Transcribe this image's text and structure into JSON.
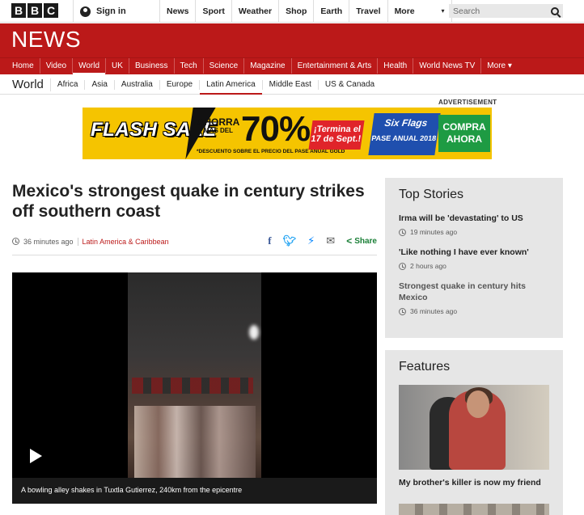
{
  "masthead": {
    "logo_letters": [
      "B",
      "B",
      "C"
    ],
    "signin_label": "Sign in",
    "nav": [
      "News",
      "Sport",
      "Weather",
      "Shop",
      "Earth",
      "Travel"
    ],
    "more_label": "More",
    "search_placeholder": "Search"
  },
  "banner": {
    "title": "NEWS"
  },
  "sections": [
    "Home",
    "Video",
    "World",
    "UK",
    "Business",
    "Tech",
    "Science",
    "Magazine",
    "Entertainment & Arts",
    "Health",
    "World News TV",
    "More"
  ],
  "active_section": "World",
  "subnav": {
    "title": "World",
    "items": [
      "Africa",
      "Asia",
      "Australia",
      "Europe",
      "Latin America",
      "Middle East",
      "US & Canada"
    ],
    "active": "Latin America"
  },
  "advertisement": {
    "label": "ADVERTISEMENT",
    "flash_sale": "FLASH SALE",
    "ahorra": "AHORRA",
    "mas_del": "MAS DEL",
    "percent": "70%",
    "disclaimer": "*DESCUENTO SOBRE EL PRECIO DEL PASE ANUAL GOLD",
    "termina": "¡Termina el 17 de Sept.!",
    "six_flags": "Six Flags",
    "pase_anual": "PASE ANUAL 2018",
    "compra": "COMPRA AHORA"
  },
  "article": {
    "headline": "Mexico's strongest quake in century strikes off southern coast",
    "time": "36 minutes ago",
    "category": "Latin America & Caribbean",
    "share_label": "Share",
    "video_caption": "A bowling alley shakes in Tuxtla Gutierrez, 240km from the epicentre"
  },
  "top_stories": {
    "title": "Top Stories",
    "items": [
      {
        "title": "Irma will be 'devastating' to US",
        "time": "19 minutes ago"
      },
      {
        "title": "'Like nothing I have ever known'",
        "time": "2 hours ago"
      },
      {
        "title": "Strongest quake in century hits Mexico",
        "time": "36 minutes ago"
      }
    ]
  },
  "features": {
    "title": "Features",
    "item_title": "My brother's killer is now my friend"
  },
  "colors": {
    "brand_red": "#bb1919",
    "panel_gray": "#e6e6e6",
    "share_green": "#1a7f37"
  }
}
